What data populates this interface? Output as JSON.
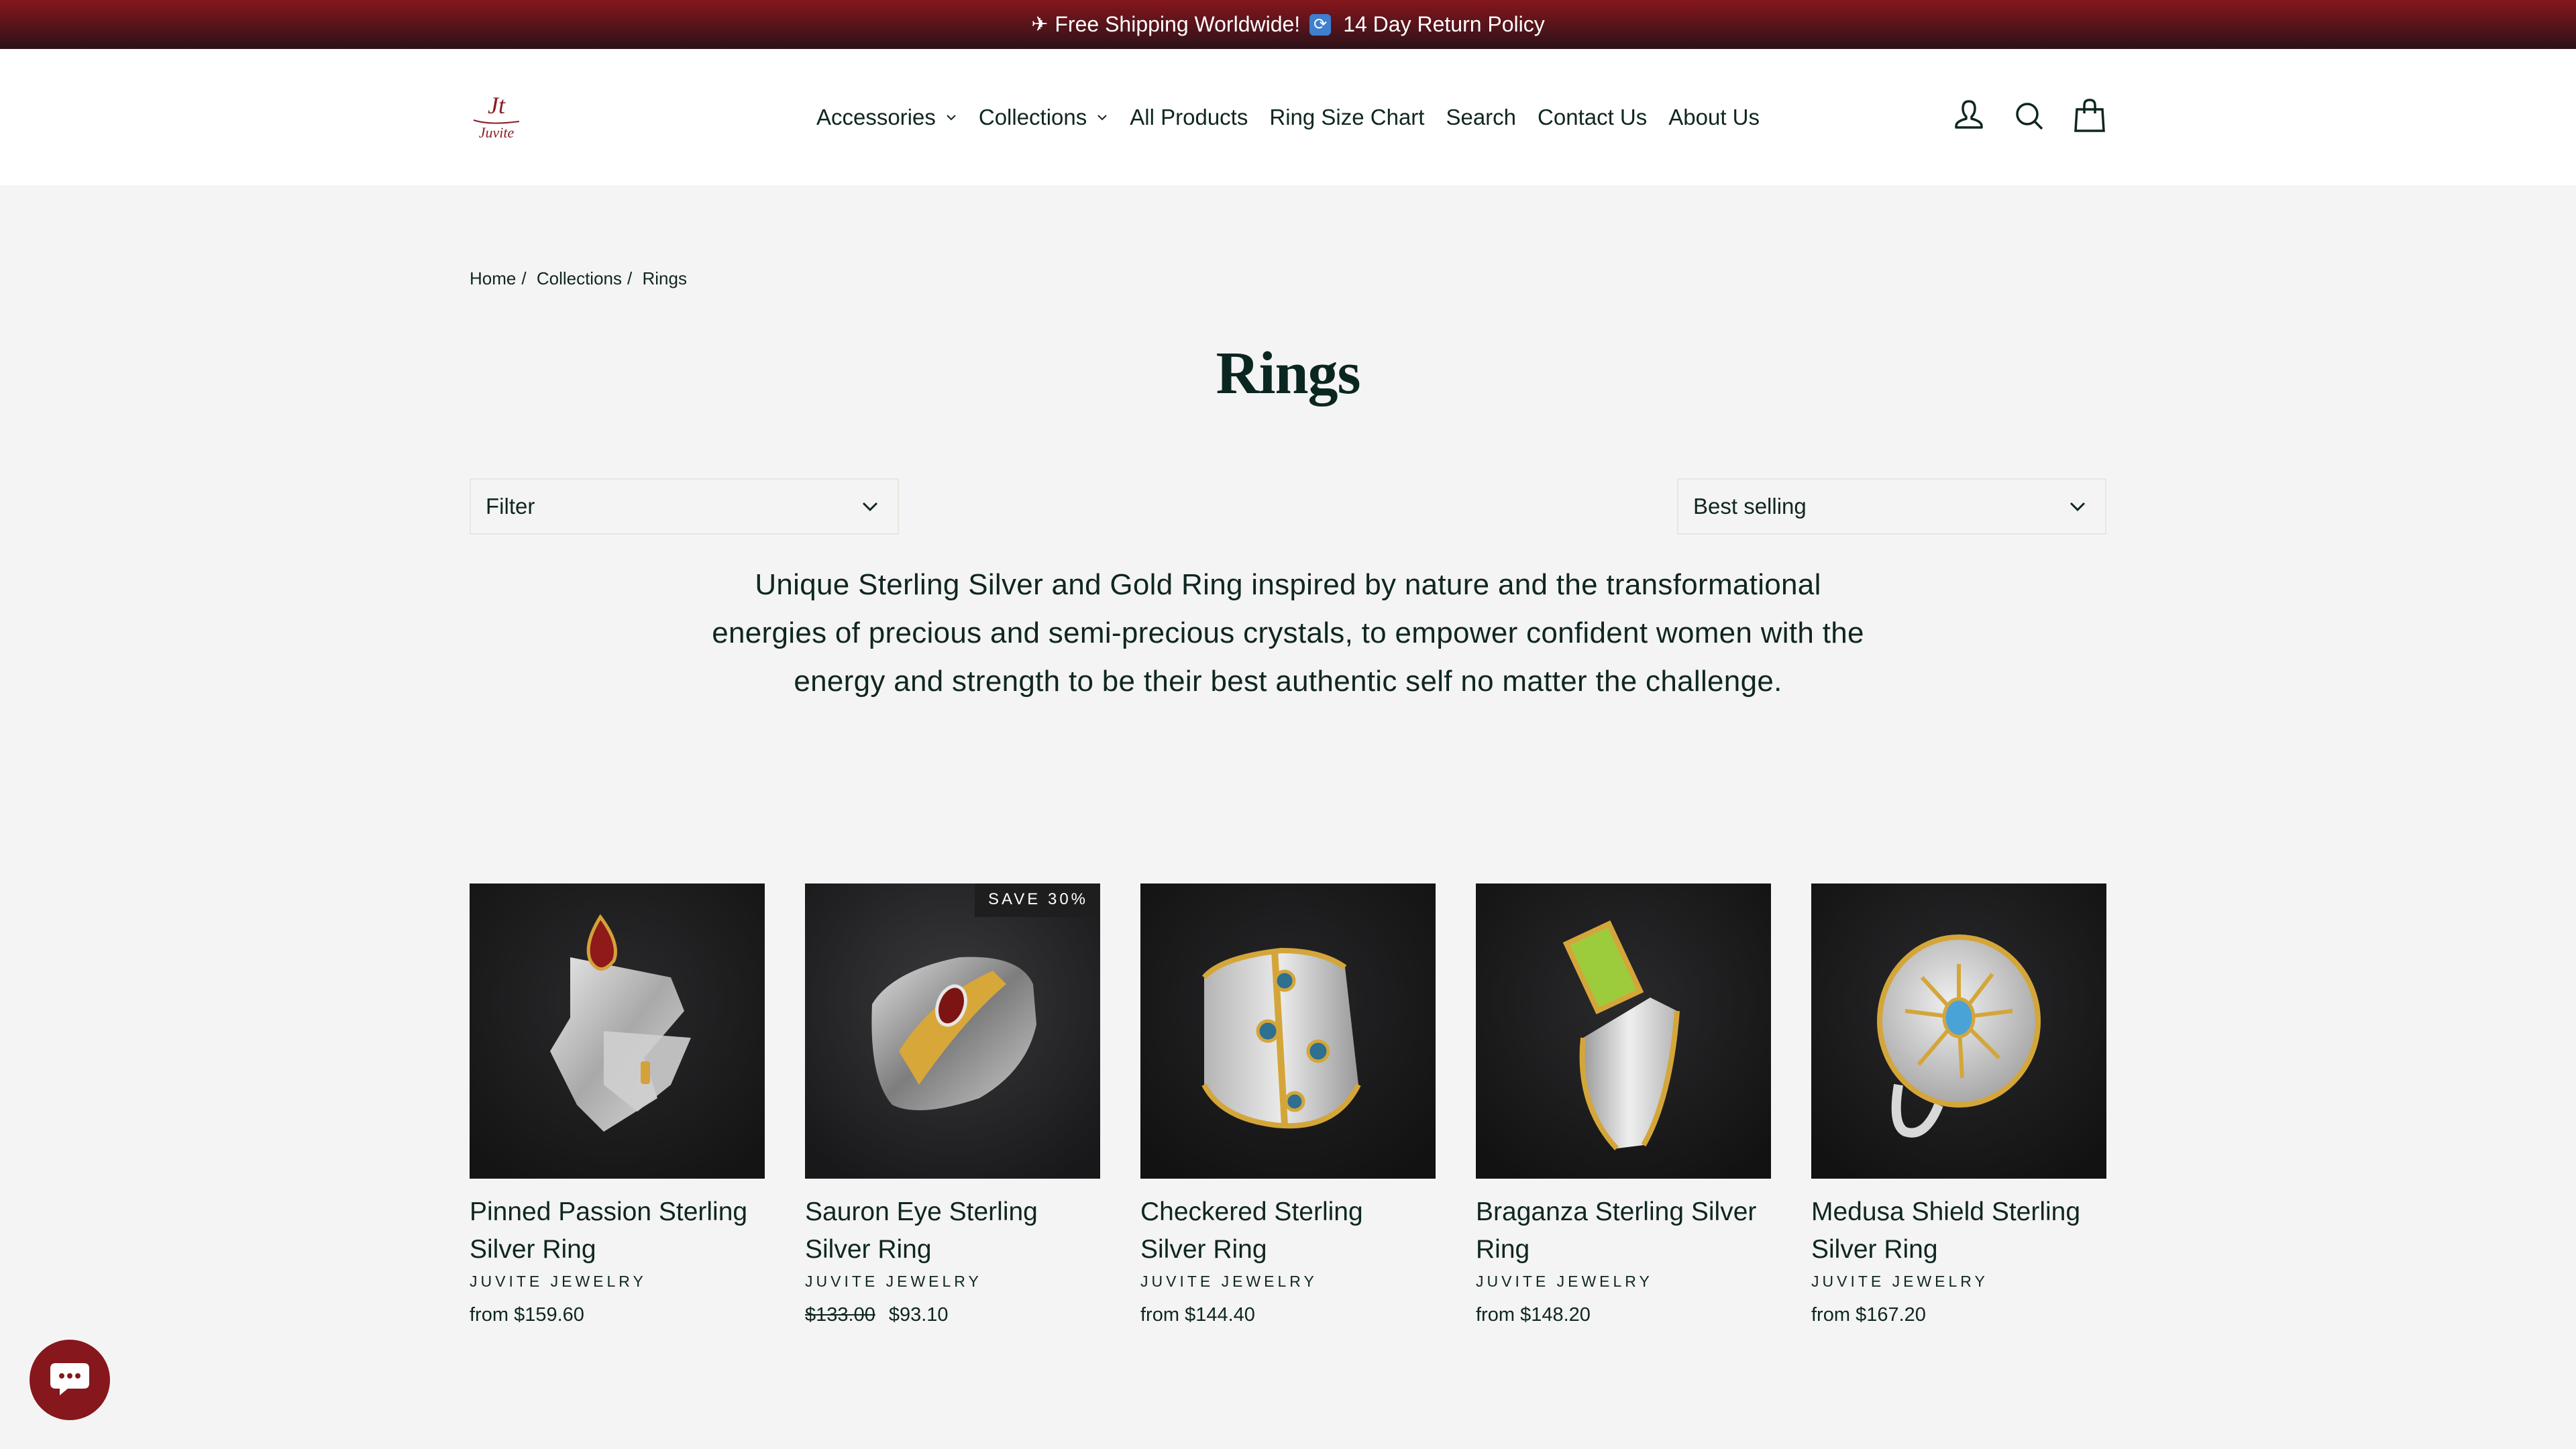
{
  "announcement": {
    "shipping_icon": "airplane-icon",
    "shipping_text": "Free Shipping Worldwide!",
    "return_icon": "sync-arrows-icon",
    "return_text": "14 Day Return Policy"
  },
  "header": {
    "logo_alt": "Juvite",
    "logo_monogram": "Jt",
    "logo_wordmark": "Juvite",
    "nav": [
      {
        "label": "Accessories",
        "has_dropdown": true
      },
      {
        "label": "Collections",
        "has_dropdown": true
      },
      {
        "label": "All Products",
        "has_dropdown": false
      },
      {
        "label": "Ring Size Chart",
        "has_dropdown": false
      },
      {
        "label": "Search",
        "has_dropdown": false
      },
      {
        "label": "Contact Us",
        "has_dropdown": false
      },
      {
        "label": "About Us",
        "has_dropdown": false
      }
    ],
    "icons": [
      "account-icon",
      "search-icon",
      "cart-icon"
    ]
  },
  "breadcrumb": {
    "items": [
      "Home",
      "Collections",
      "Rings"
    ],
    "separator": "/"
  },
  "page": {
    "title": "Rings",
    "filter_label": "Filter",
    "sort_value": "Best selling",
    "description": "Unique Sterling Silver and Gold Ring inspired by nature and the transformational energies of precious and semi-precious crystals, to empower confident women with the energy and strength to be their best authentic self no matter the challenge."
  },
  "products": [
    {
      "title": "Pinned Passion Sterling Silver Ring",
      "vendor": "JUVITE JEWELRY",
      "price_prefix": "from",
      "price": "$159.60",
      "compare_price": null,
      "badge": null,
      "stone_color": "#8e1a1a"
    },
    {
      "title": "Sauron Eye Sterling Silver Ring",
      "vendor": "JUVITE JEWELRY",
      "price_prefix": "",
      "price": "$93.10",
      "compare_price": "$133.00",
      "badge": "SAVE 30%",
      "stone_color": "#7d1414"
    },
    {
      "title": "Checkered Sterling Silver Ring",
      "vendor": "JUVITE JEWELRY",
      "price_prefix": "from",
      "price": "$144.40",
      "compare_price": null,
      "badge": null,
      "stone_color": "#2f6f8f"
    },
    {
      "title": "Braganza Sterling Silver Ring",
      "vendor": "JUVITE JEWELRY",
      "price_prefix": "from",
      "price": "$148.20",
      "compare_price": null,
      "badge": null,
      "stone_color": "#9ccc3c"
    },
    {
      "title": "Medusa Shield Sterling Silver Ring",
      "vendor": "JUVITE JEWELRY",
      "price_prefix": "from",
      "price": "$167.20",
      "compare_price": null,
      "badge": null,
      "stone_color": "#4aa3d6"
    }
  ],
  "chat": {
    "icon": "chat-bubble-icon"
  },
  "colors": {
    "brand": "#86171c",
    "text": "#0f2621",
    "background": "#f4f4f4"
  }
}
